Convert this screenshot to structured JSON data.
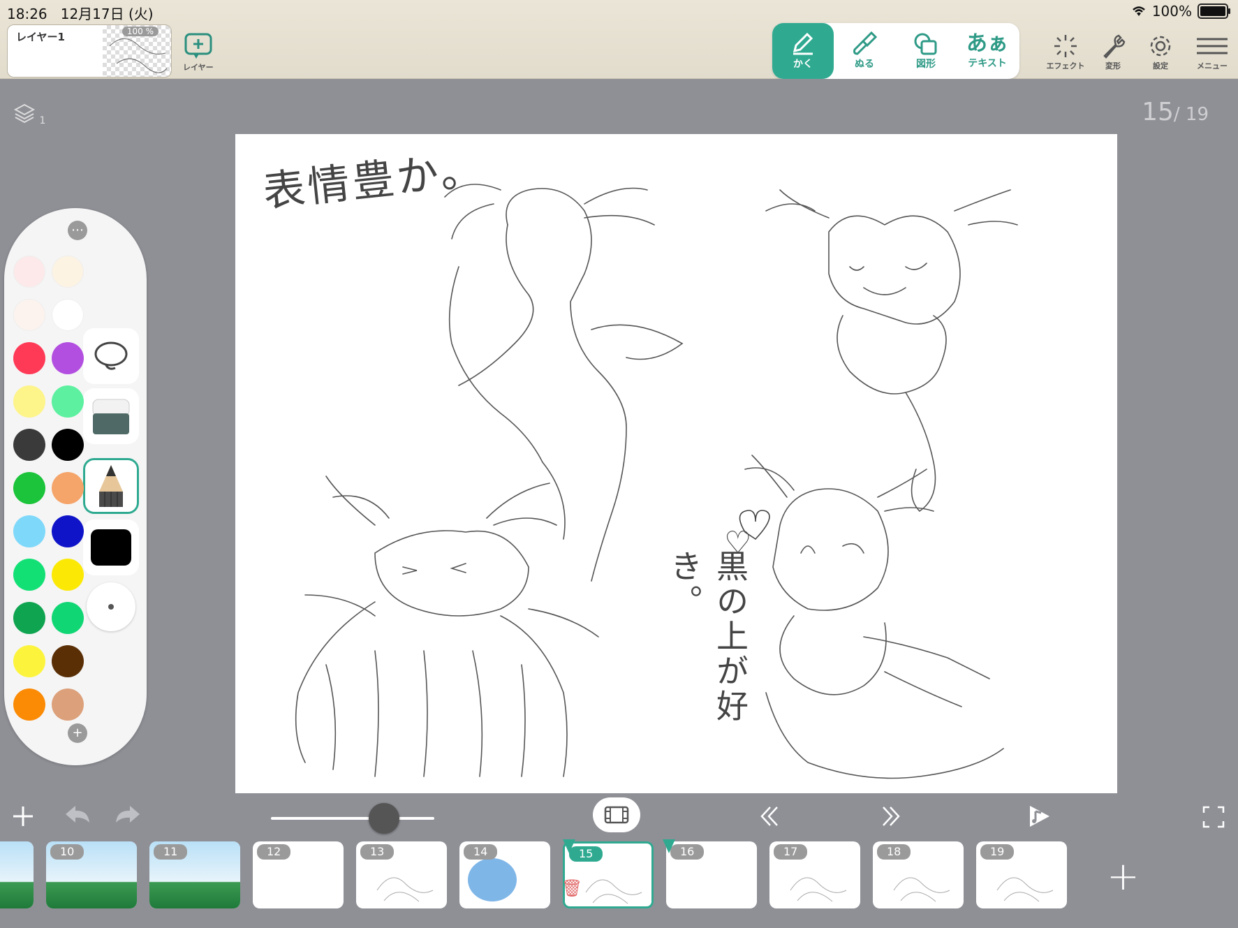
{
  "status": {
    "time": "18:26",
    "date": "12月17日 (火)",
    "wifi": "wifi-icon",
    "battery": "100%"
  },
  "layer_chip": {
    "name": "レイヤー1",
    "opacity": "100 %"
  },
  "toolbar": {
    "layer_button": "レイヤー",
    "modes": [
      {
        "label": "かく",
        "icon": "pencil-icon",
        "active": true
      },
      {
        "label": "ぬる",
        "icon": "brush-icon",
        "active": false
      },
      {
        "label": "図形",
        "icon": "shape-icon",
        "active": false
      },
      {
        "label": "テキスト",
        "glyph": "あぁ",
        "icon": "text-icon",
        "active": false
      }
    ],
    "right": [
      {
        "label": "エフェクト",
        "icon": "sparkle-icon"
      },
      {
        "label": "変形",
        "icon": "wrench-icon"
      },
      {
        "label": "設定",
        "icon": "gear-icon"
      },
      {
        "label": "メニュー",
        "icon": "hamburger-icon"
      }
    ]
  },
  "canvas": {
    "layer_count": "1",
    "page_current": "15",
    "page_total": "/ 19",
    "texts": {
      "title": "表情豊か。",
      "side_note": "黒の上が好き。",
      "heart": "♡"
    }
  },
  "palette": {
    "colors": [
      "#fde9e9",
      "#fdf3e3",
      "#fdf3ee",
      "#ffffff",
      "#ff3a57",
      "#b34fe0",
      "#fdf48a",
      "#5cf0a0",
      "#3a3a3a",
      "#000000",
      "#1bc43a",
      "#f5a46a",
      "#7ed8fa",
      "#0f14c8",
      "#12e075",
      "#fbe905",
      "#0fa450",
      "#10d674",
      "#fcf43c",
      "#5a2f06",
      "#fb8a04",
      "#dca07a"
    ],
    "tools": [
      "lasso-icon",
      "eraser-icon",
      "pencil-tool-icon",
      "black-color-square",
      "brush-size-dot"
    ]
  },
  "bottom": {
    "slider_value": 0.7
  },
  "frames": [
    {
      "num": "",
      "kind": "green"
    },
    {
      "num": "10",
      "kind": "green"
    },
    {
      "num": "11",
      "kind": "green"
    },
    {
      "num": "12",
      "kind": "blank"
    },
    {
      "num": "13",
      "kind": "sketch"
    },
    {
      "num": "14",
      "kind": "blue"
    },
    {
      "num": "15",
      "kind": "sketch",
      "current": true
    },
    {
      "num": "16",
      "kind": "blank"
    },
    {
      "num": "17",
      "kind": "sketch"
    },
    {
      "num": "18",
      "kind": "sketch"
    },
    {
      "num": "19",
      "kind": "sketch"
    }
  ]
}
